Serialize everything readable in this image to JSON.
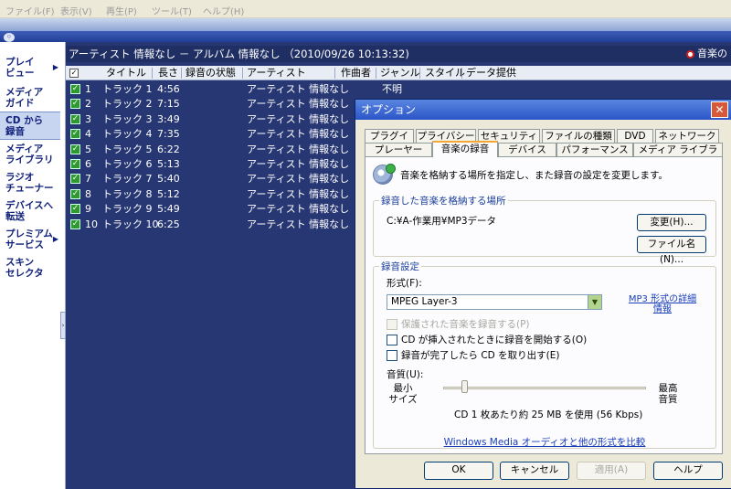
{
  "menu": [
    "ファイル(F)",
    "表示(V)",
    "再生(P)",
    "ツール(T)",
    "ヘルプ(H)"
  ],
  "sidebar": {
    "items": [
      {
        "label": "プレイ\nビュー",
        "arrow": "▶"
      },
      {
        "label": "メディア\nガイド",
        "arrow": ""
      },
      {
        "label": "CD から\n録音",
        "arrow": ""
      },
      {
        "label": "メディア\nライブラリ",
        "arrow": ""
      },
      {
        "label": "ラジオ\nチューナー",
        "arrow": ""
      },
      {
        "label": "デバイスへ\n転送",
        "arrow": ""
      },
      {
        "label": "プレミアム\nサービス",
        "arrow": "▶"
      },
      {
        "label": "スキン\nセレクタ",
        "arrow": ""
      }
    ],
    "active_index": 2,
    "grip": "›"
  },
  "main": {
    "title": "アーティスト 情報なし － アルバム 情報なし （2010/09/26 10:13:32)",
    "rec_indicator": "音楽の",
    "columns": [
      "タイトル",
      "長さ",
      "録音の状態",
      "アーティスト",
      "作曲者",
      "ジャンル",
      "スタイル",
      "データ提供"
    ],
    "tracks": [
      {
        "num": "1",
        "title": "トラック 1",
        "length": "4:56",
        "artist": "アーティスト 情報なし",
        "genre": "不明"
      },
      {
        "num": "2",
        "title": "トラック 2",
        "length": "7:15",
        "artist": "アーティスト 情報なし",
        "genre": ""
      },
      {
        "num": "3",
        "title": "トラック 3",
        "length": "3:49",
        "artist": "アーティスト 情報なし",
        "genre": ""
      },
      {
        "num": "4",
        "title": "トラック 4",
        "length": "7:35",
        "artist": "アーティスト 情報なし",
        "genre": ""
      },
      {
        "num": "5",
        "title": "トラック 5",
        "length": "6:22",
        "artist": "アーティスト 情報なし",
        "genre": ""
      },
      {
        "num": "6",
        "title": "トラック 6",
        "length": "5:13",
        "artist": "アーティスト 情報なし",
        "genre": ""
      },
      {
        "num": "7",
        "title": "トラック 7",
        "length": "5:40",
        "artist": "アーティスト 情報なし",
        "genre": ""
      },
      {
        "num": "8",
        "title": "トラック 8",
        "length": "5:12",
        "artist": "アーティスト 情報なし",
        "genre": ""
      },
      {
        "num": "9",
        "title": "トラック 9",
        "length": "5:49",
        "artist": "アーティスト 情報なし",
        "genre": ""
      },
      {
        "num": "10",
        "title": "トラック 10",
        "length": "6:25",
        "artist": "アーティスト 情報なし",
        "genre": ""
      }
    ]
  },
  "dialog": {
    "title": "オプション",
    "close": "✕",
    "tabs_row1": [
      "プラグイン",
      "プライバシー",
      "セキュリティ",
      "ファイルの種類",
      "DVD",
      "ネットワーク"
    ],
    "tabs_row2": [
      "プレーヤー",
      "音楽の録音",
      "デバイス",
      "パフォーマンス",
      "メディア ライブラリ"
    ],
    "active_tab": "音楽の録音",
    "description": "音楽を格納する場所を指定し、また録音の設定を変更します。",
    "location_group": {
      "label": "録音した音楽を格納する場所",
      "path": "C:¥A-作業用¥MP3データ",
      "change_button": "変更(H)...",
      "filename_button": "ファイル名(N)..."
    },
    "settings_group": {
      "label": "録音設定",
      "format_label": "形式(F):",
      "format_value": "MPEG Layer-3",
      "format_link": "MP3 形式の詳細情報",
      "checkboxes": [
        {
          "label": "保護された音楽を録音する(P)",
          "checked": false,
          "disabled": true
        },
        {
          "label": "CD が挿入されたときに録音を開始する(O)",
          "checked": false,
          "disabled": false
        },
        {
          "label": "録音が完了したら CD を取り出す(E)",
          "checked": false,
          "disabled": false
        }
      ],
      "quality_label": "音質(U):",
      "quality_min": "最小\nサイズ",
      "quality_max": "最高\n音質",
      "quality_level": 0,
      "quality_info": "CD 1 枚あたり約 25 MB を使用 (56 Kbps)"
    },
    "compare_link": "Windows Media オーディオと他の形式を比較",
    "buttons": {
      "ok": "OK",
      "cancel": "キャンセル",
      "apply": "適用(A)",
      "help": "ヘルプ"
    }
  }
}
